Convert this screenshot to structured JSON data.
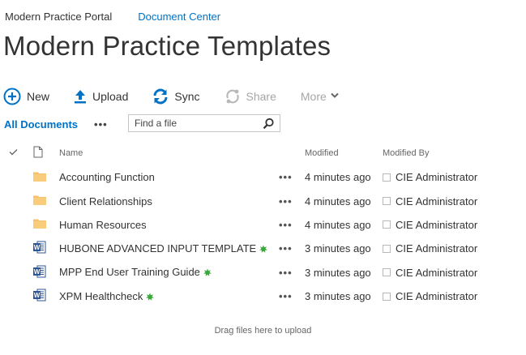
{
  "nav": {
    "site": "Modern Practice Portal",
    "current": "Document Center"
  },
  "page": {
    "title": "Modern Practice Templates"
  },
  "commands": {
    "new": "New",
    "upload": "Upload",
    "sync": "Sync",
    "share": "Share",
    "more": "More"
  },
  "view": {
    "name": "All Documents",
    "ellipsis": "•••",
    "search_placeholder": "Find a file"
  },
  "columns": {
    "name": "Name",
    "modified": "Modified",
    "modified_by": "Modified By"
  },
  "rows": [
    {
      "type": "folder",
      "name": "Accounting Function",
      "new": false,
      "modified": "4 minutes ago",
      "modified_by": "CIE Administrator"
    },
    {
      "type": "folder",
      "name": "Client Relationships",
      "new": false,
      "modified": "4 minutes ago",
      "modified_by": "CIE Administrator"
    },
    {
      "type": "folder",
      "name": "Human Resources",
      "new": false,
      "modified": "4 minutes ago",
      "modified_by": "CIE Administrator"
    },
    {
      "type": "word",
      "name": "HUBONE ADVANCED INPUT TEMPLATE",
      "new": true,
      "modified": "3 minutes ago",
      "modified_by": "CIE Administrator"
    },
    {
      "type": "word",
      "name": "MPP End User Training Guide",
      "new": true,
      "modified": "3 minutes ago",
      "modified_by": "CIE Administrator"
    },
    {
      "type": "word",
      "name": "XPM Healthcheck",
      "new": true,
      "modified": "3 minutes ago",
      "modified_by": "CIE Administrator"
    }
  ],
  "row_more": "•••",
  "footer": {
    "drop_text": "Drag files here to upload"
  },
  "colors": {
    "accent": "#0072c6",
    "folder": "#f5c26b",
    "word": "#2b579a",
    "new_badge": "#3aa83a",
    "disabled": "#a6a6a6"
  }
}
